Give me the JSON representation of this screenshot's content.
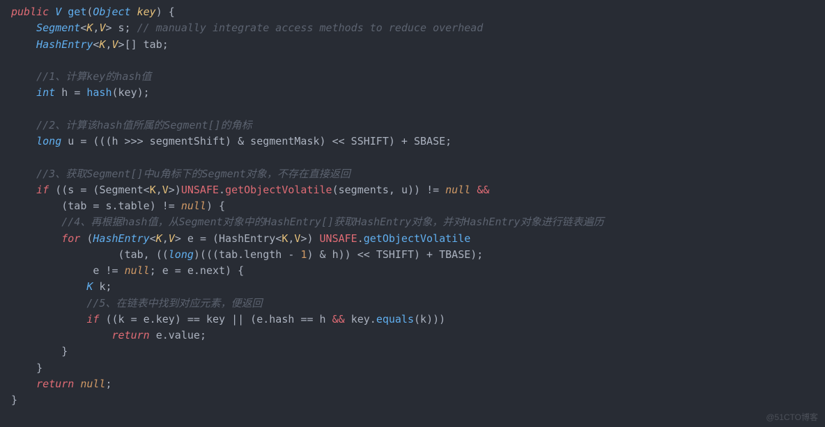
{
  "code": {
    "l1": {
      "kw": "public",
      "type": "V",
      "fn": "get",
      "ptype": "Object",
      "pname": "key"
    },
    "l2": {
      "type": "Segment",
      "k": "K",
      "v": "V",
      "n": "s",
      "c": "// manually integrate access methods to reduce overhead"
    },
    "l3": {
      "type": "HashEntry",
      "k": "K",
      "v": "V",
      "arr": "[]",
      "n": "tab"
    },
    "l5": {
      "c": "//1、计算key的hash值"
    },
    "l6": {
      "type": "int",
      "n": "h",
      "fn": "hash",
      "a": "key"
    },
    "l8": {
      "c": "//2、计算该hash值所属的Segment[]的角标"
    },
    "l9": {
      "type": "long",
      "n": "u",
      "e1": "(((h >>> segmentShift) & segmentMask) << SSHIFT) + SBASE;"
    },
    "l11": {
      "c": "//3、获取Segment[]中u角标下的Segment对象，不存在直接返回"
    },
    "l12": {
      "kw": "if",
      "segs": "segments",
      "u": "u",
      "nul": "null",
      "amp": "&&"
    },
    "l13": {
      "tab": "tab",
      "s": "s",
      "table": "table",
      "nul": "null"
    },
    "l14": {
      "c": "//4、再根据hash值，从Segment对象中的HashEntry[]获取HashEntry对象，并对HashEntry对象进行链表遍历"
    },
    "l15": {
      "kw": "for",
      "type": "HashEntry",
      "k": "K",
      "v": "V",
      "n": "e",
      "cast": "HashEntry",
      "fn": "getObjectVolatile"
    },
    "l16": {
      "tab": "tab",
      "lng": "long",
      "tablen": "tab.length",
      "one": "1",
      "h": "h",
      "tshift": "TSHIFT",
      "tbase": "TBASE"
    },
    "l17": {
      "e": "e",
      "nul": "null",
      "next": "e.next"
    },
    "l18": {
      "type": "K",
      "n": "k"
    },
    "l19": {
      "c": "//5、在链表中找到对应元素，便返回"
    },
    "l20": {
      "kw": "if",
      "k": "k",
      "ekey": "e.key",
      "key": "key",
      "ehash": "e.hash",
      "h": "h",
      "amp": "&&",
      "eq": "equals",
      "k2": "k"
    },
    "l21": {
      "kw": "return",
      "val": "e.value"
    },
    "l24": {
      "kw": "return",
      "nul": "null"
    }
  },
  "watermark": "@51CTO博客"
}
